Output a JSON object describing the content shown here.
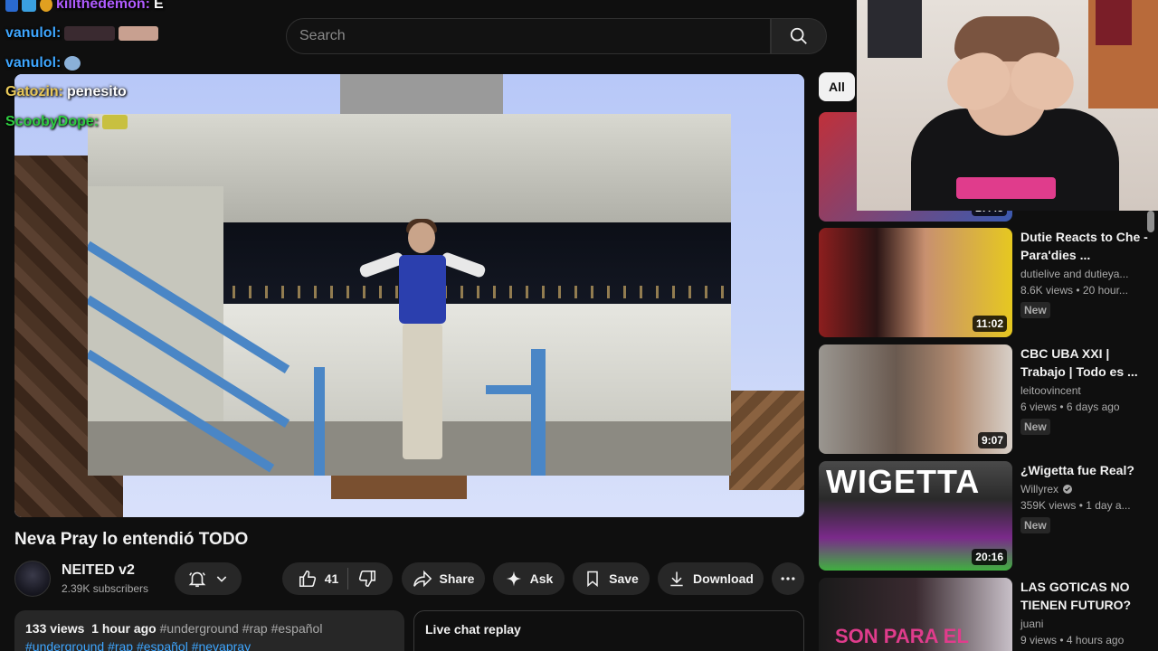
{
  "search": {
    "placeholder": "Search"
  },
  "chat": [
    {
      "user": "killthedemon:",
      "message": "E",
      "color": "#b05cff"
    },
    {
      "user": "vanulol:",
      "message": "",
      "color": "#3ea6ff"
    },
    {
      "user": "vanulol:",
      "message": "",
      "color": "#3ea6ff"
    },
    {
      "user": "Gatozin:",
      "message": "penesito",
      "color": "#e8c85a"
    },
    {
      "user": "ScoobyDope:",
      "message": "",
      "color": "#2ecc40"
    }
  ],
  "video": {
    "title": "Neva Pray lo entendió TODO",
    "channel": "NEITED v2",
    "subscribers": "2.39K subscribers",
    "likes": "41",
    "share_label": "Share",
    "ask_label": "Ask",
    "save_label": "Save",
    "download_label": "Download",
    "meta": "133 views  1 hour ago",
    "hashtags_inline": "#underground #rap #español",
    "hashtags_line2": "#underground #rap #español #nevapray",
    "live_chat_label": "Live chat replay"
  },
  "sidebar": {
    "chip_all": "All",
    "recommendations": [
      {
        "title": "",
        "channel": "",
        "stats": "",
        "duration": "27:48",
        "new_badge": "",
        "verified": false,
        "thumb_color": "#b0303a"
      },
      {
        "title": "Dutie Reacts to Che - Para'dies ...",
        "channel": "dutielive and dutieya...",
        "stats": "8.6K views • 20 hour...",
        "duration": "11:02",
        "new_badge": "New",
        "verified": false,
        "thumb_color": "#8c1e1e"
      },
      {
        "title": "CBC UBA XXI | Trabajo | Todo es ...",
        "channel": "leitoovincent",
        "stats": "6 views • 6 days ago",
        "duration": "9:07",
        "new_badge": "New",
        "verified": false,
        "thumb_color": "#6a5a50"
      },
      {
        "title": "¿Wigetta fue Real?",
        "channel": "Willyrex",
        "stats": "359K views • 1 day a...",
        "duration": "20:16",
        "new_badge": "New",
        "verified": true,
        "thumb_color": "#3a3a3a",
        "thumb_text": "WIGETTA"
      },
      {
        "title": "LAS GOTICAS NO TIENEN FUTURO?",
        "channel": "juani",
        "stats": "9 views • 4 hours ago",
        "duration": "",
        "new_badge": "",
        "verified": false,
        "thumb_color": "#2a1a24",
        "thumb_text": "SON PARA EL"
      }
    ]
  },
  "colors": {
    "accent": "#3ea6ff",
    "background": "#0f0f0f",
    "pill": "#272727"
  },
  "icons": [
    "search-icon",
    "bell-icon",
    "chevron-down-icon",
    "like-icon",
    "dislike-icon",
    "share-icon",
    "ask-sparkle-icon",
    "save-icon",
    "download-icon",
    "more-icon",
    "verified-icon"
  ]
}
